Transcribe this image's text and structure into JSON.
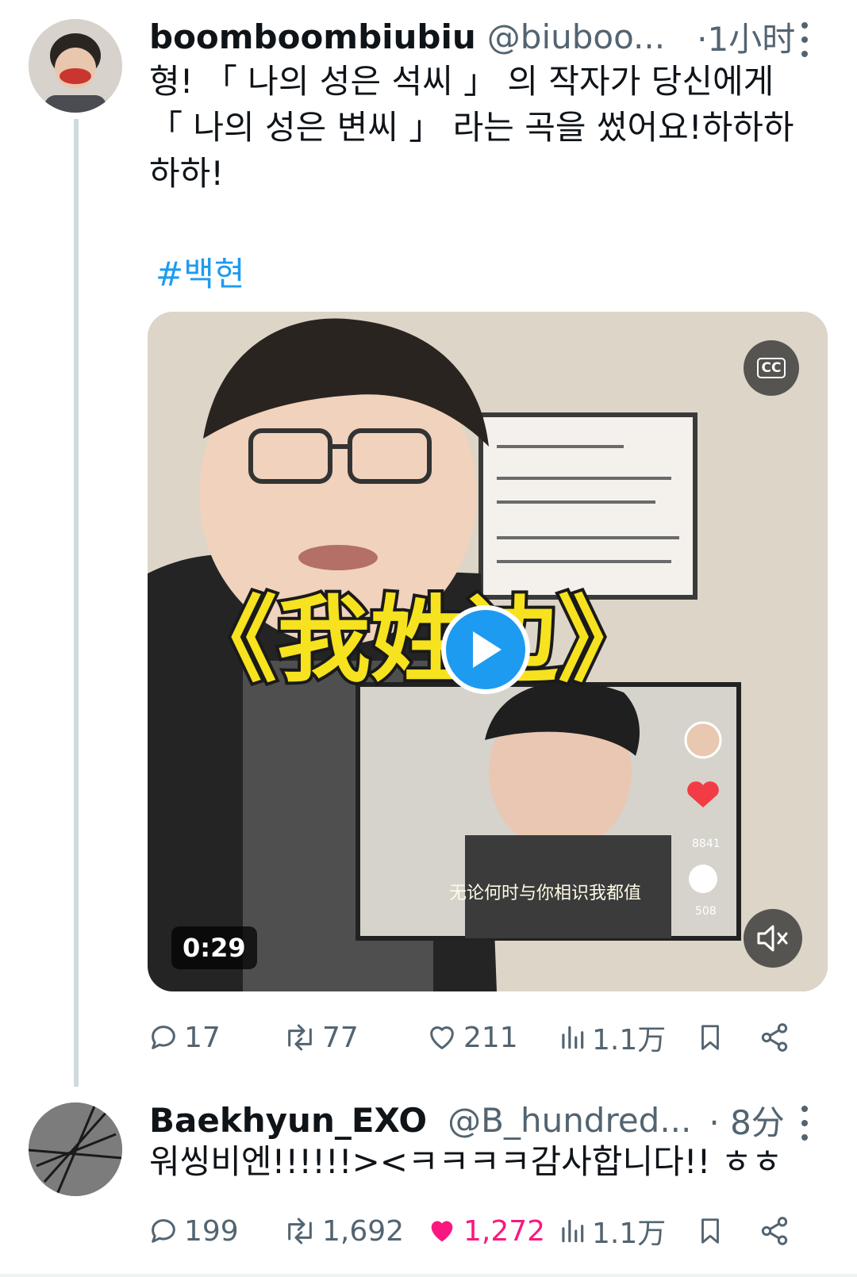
{
  "tweet1": {
    "display_name": "boomboombiubiu",
    "handle": "@biuboo...",
    "time": "·1小时",
    "text_lines": [
      "형! 「 나의 성은 석씨 」 의 작자가 당신에게",
      "「 나의 성은 변씨 」  라는 곡을 썼어요!하하하",
      "하하!"
    ],
    "hashtag": "#백현",
    "video": {
      "duration": "0:29",
      "cc_label": "CC"
    },
    "actions": {
      "replies": "17",
      "retweets": "77",
      "likes": "211",
      "views": "1.1万"
    }
  },
  "tweet2": {
    "display_name": "Baekhyun_EXO",
    "handle": "@B_hundred...",
    "time": "· 8分",
    "text": "워씽비엔!!!!!!><ㅋㅋㅋㅋ감사합니다!! ㅎㅎ",
    "actions": {
      "replies": "199",
      "retweets": "1,692",
      "likes": "1,272",
      "views": "1.1万"
    }
  },
  "colors": {
    "accent": "#1d9bf0",
    "secondary_text": "#536471",
    "primary_text": "#0f1419",
    "like_pink": "#f91880"
  }
}
